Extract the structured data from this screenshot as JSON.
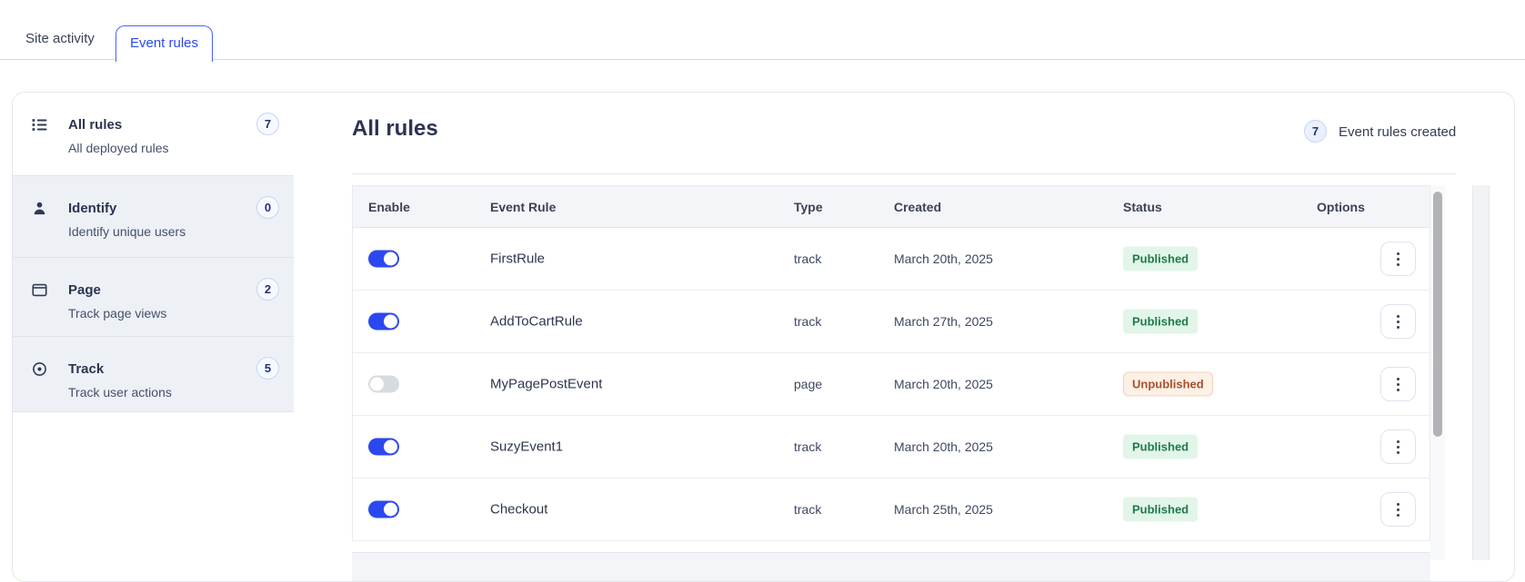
{
  "tabs": [
    {
      "label": "Site activity",
      "active": false
    },
    {
      "label": "Event rules",
      "active": true
    }
  ],
  "sidebar": {
    "items": [
      {
        "icon": "list-icon",
        "title": "All rules",
        "count": "7",
        "subtitle": "All deployed rules",
        "selected": true
      },
      {
        "icon": "user-icon",
        "title": "Identify",
        "count": "0",
        "subtitle": "Identify unique users",
        "selected": false
      },
      {
        "icon": "window-icon",
        "title": "Page",
        "count": "2",
        "subtitle": "Track page views",
        "selected": false
      },
      {
        "icon": "target-icon",
        "title": "Track",
        "count": "5",
        "subtitle": "Track user actions",
        "selected": false
      }
    ]
  },
  "main": {
    "title": "All rules",
    "summary_count": "7",
    "summary_label": "Event rules created"
  },
  "table": {
    "columns": [
      "Enable",
      "Event Rule",
      "Type",
      "Created",
      "Status",
      "Options"
    ],
    "rows": [
      {
        "enabled": true,
        "name": "FirstRule",
        "type": "track",
        "created": "March 20th, 2025",
        "status": "Published"
      },
      {
        "enabled": true,
        "name": "AddToCartRule",
        "type": "track",
        "created": "March 27th, 2025",
        "status": "Published"
      },
      {
        "enabled": false,
        "name": "MyPagePostEvent",
        "type": "page",
        "created": "March 20th, 2025",
        "status": "Unpublished"
      },
      {
        "enabled": true,
        "name": "SuzyEvent1",
        "type": "track",
        "created": "March 20th, 2025",
        "status": "Published"
      },
      {
        "enabled": true,
        "name": "Checkout",
        "type": "track",
        "created": "March 25th, 2025",
        "status": "Published"
      }
    ]
  },
  "colors": {
    "accent_blue": "#2b48f0",
    "tab_border_blue": "#4a63f5",
    "badge_circle_border": "#c5d5f8",
    "badge_circle_text": "#22307f",
    "published_bg": "#e2f5e9",
    "published_text": "#1f7a4b",
    "unpublished_bg": "#fdf0e5",
    "unpublished_text": "#a7502e",
    "toggle_off": "#d7dbe1",
    "sidebar_item_bg": "#edf1f6",
    "table_header_bg": "#f4f5f8"
  }
}
